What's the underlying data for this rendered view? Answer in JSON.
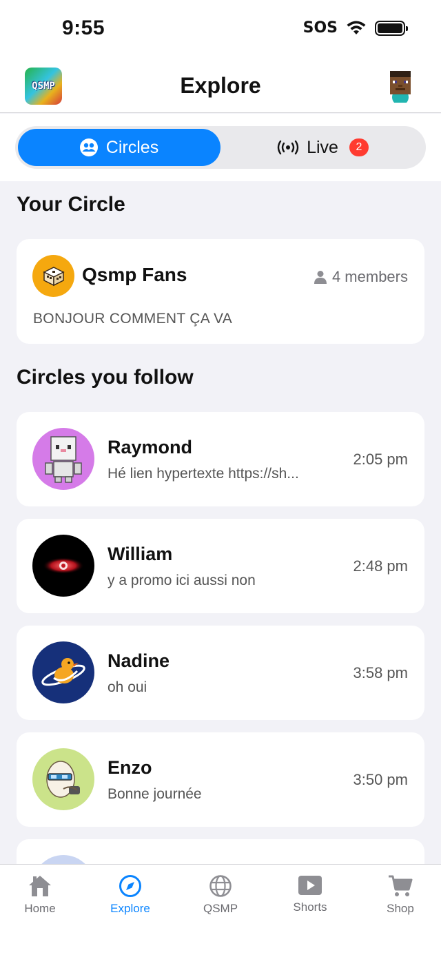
{
  "status_bar": {
    "time": "9:55",
    "sos": "SOS"
  },
  "header": {
    "title": "Explore",
    "logo_text": "QSMP"
  },
  "segmented": {
    "circles_label": "Circles",
    "live_label": "Live",
    "live_badge": "2"
  },
  "your_circle": {
    "section_title": "Your Circle",
    "name": "Qsmp Fans",
    "members": "4 members",
    "message": "BONJOUR COMMENT ÇA VA"
  },
  "follow": {
    "section_title": "Circles you follow",
    "items": [
      {
        "name": "Raymond",
        "message": "Hé lien hypertexte https://sh...",
        "time": "2:05 pm",
        "avatar_color": "#d57be8"
      },
      {
        "name": "William",
        "message": "y a promo ici aussi non",
        "time": "2:48 pm",
        "avatar_color": "#000000"
      },
      {
        "name": "Nadine",
        "message": "oh oui",
        "time": "3:58 pm",
        "avatar_color": "#16307a"
      },
      {
        "name": "Enzo",
        "message": "Bonne journée",
        "time": "3:50 pm",
        "avatar_color": "#cbe38a"
      }
    ]
  },
  "tabbar": {
    "home": "Home",
    "explore": "Explore",
    "qsmp": "QSMP",
    "shorts": "Shorts",
    "shop": "Shop",
    "accent": "#0a84ff"
  }
}
